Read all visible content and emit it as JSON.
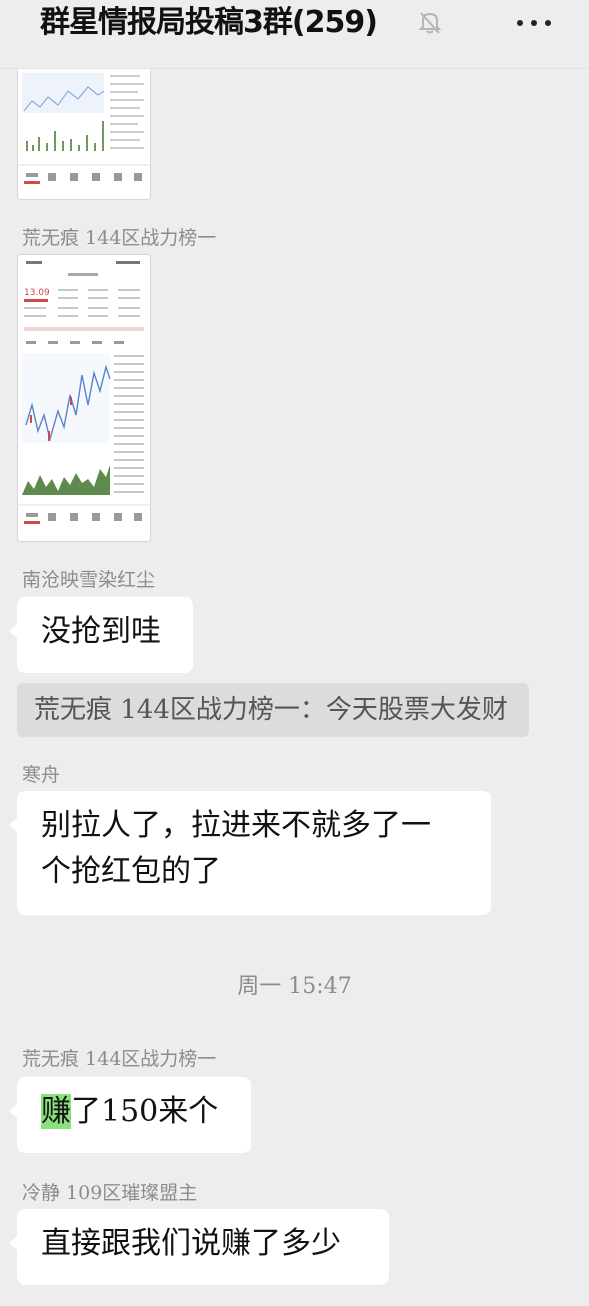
{
  "header": {
    "title": "群星情报局投稿3群(259)",
    "mute_icon": "bell-off-icon",
    "more_icon": "more-dots-icon"
  },
  "messages": [
    {
      "type": "image",
      "sender": "",
      "content": "stock-chart-screenshot"
    },
    {
      "type": "image",
      "sender": "荒无痕 144区战力榜一",
      "content": "stock-chart-screenshot",
      "price": "13.09"
    },
    {
      "type": "text",
      "sender": "南沧映雪染红尘",
      "text": "没抢到哇"
    },
    {
      "type": "quote",
      "text": "荒无痕 144区战力榜一：今天股票大发财"
    },
    {
      "type": "text",
      "sender": "寒舟",
      "lines": [
        "别拉人了，拉进来不就多了一",
        "个抢红包的了"
      ]
    },
    {
      "type": "time",
      "text": "周一 15:47"
    },
    {
      "type": "text",
      "sender": "荒无痕 144区战力榜一",
      "highlight": "赚",
      "rest": "了150来个"
    },
    {
      "type": "text",
      "sender": "冷静 109区璀璨盟主",
      "text": "直接跟我们说赚了多少"
    }
  ]
}
